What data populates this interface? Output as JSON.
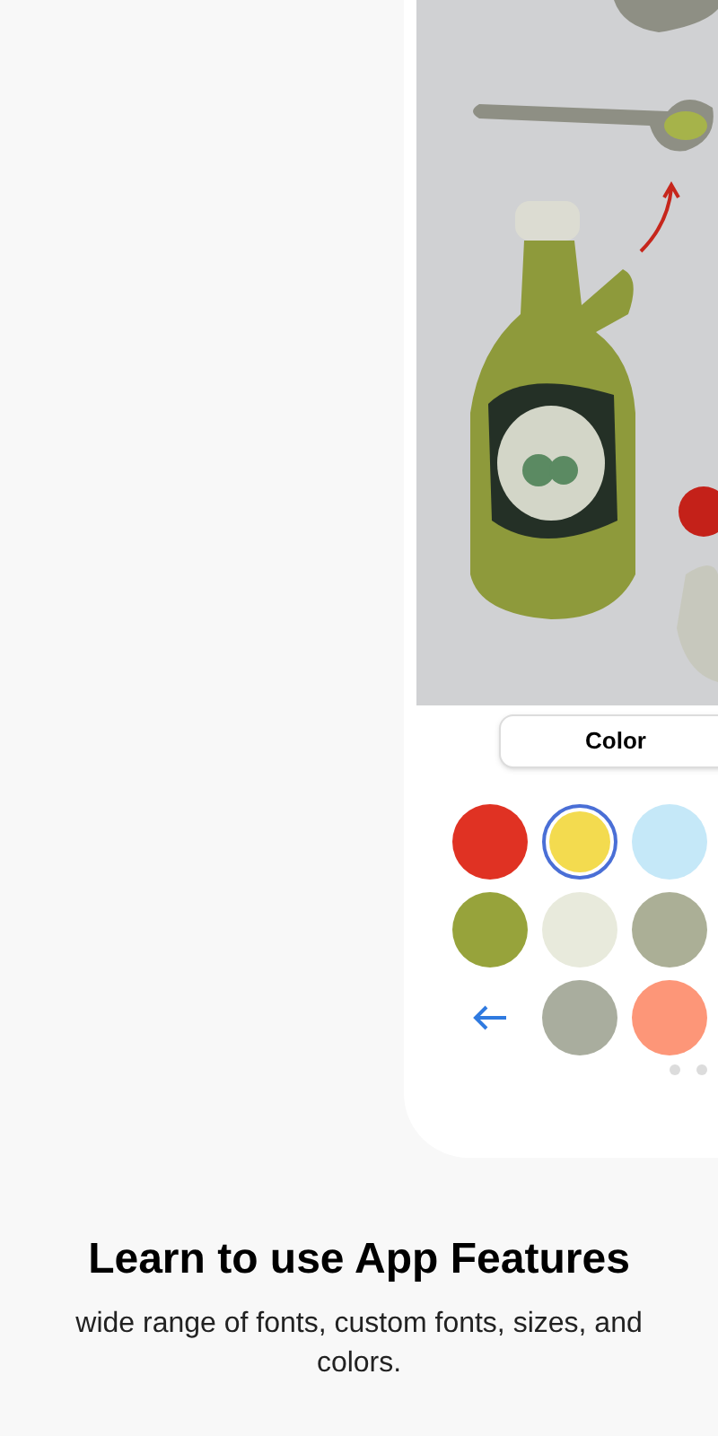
{
  "preview": {
    "tab": {
      "label": "Color"
    },
    "palette": [
      {
        "kind": "swatch",
        "color": "#e03223",
        "selected": false
      },
      {
        "kind": "swatch",
        "color": "#f3db4f",
        "selected": true
      },
      {
        "kind": "swatch",
        "color": "#c5e8f8",
        "selected": false
      },
      {
        "kind": "swatch",
        "color": "#97a33b",
        "selected": false
      },
      {
        "kind": "swatch",
        "color": "#e8eadc",
        "selected": false
      },
      {
        "kind": "swatch",
        "color": "#abaf96",
        "selected": false
      },
      {
        "kind": "back"
      },
      {
        "kind": "swatch",
        "color": "#a9ad9e",
        "selected": false
      },
      {
        "kind": "swatch",
        "color": "#fd9678",
        "selected": false
      }
    ]
  },
  "title": "Learn to use App Features",
  "subtitle": "wide range of fonts, custom fonts, sizes, and colors."
}
